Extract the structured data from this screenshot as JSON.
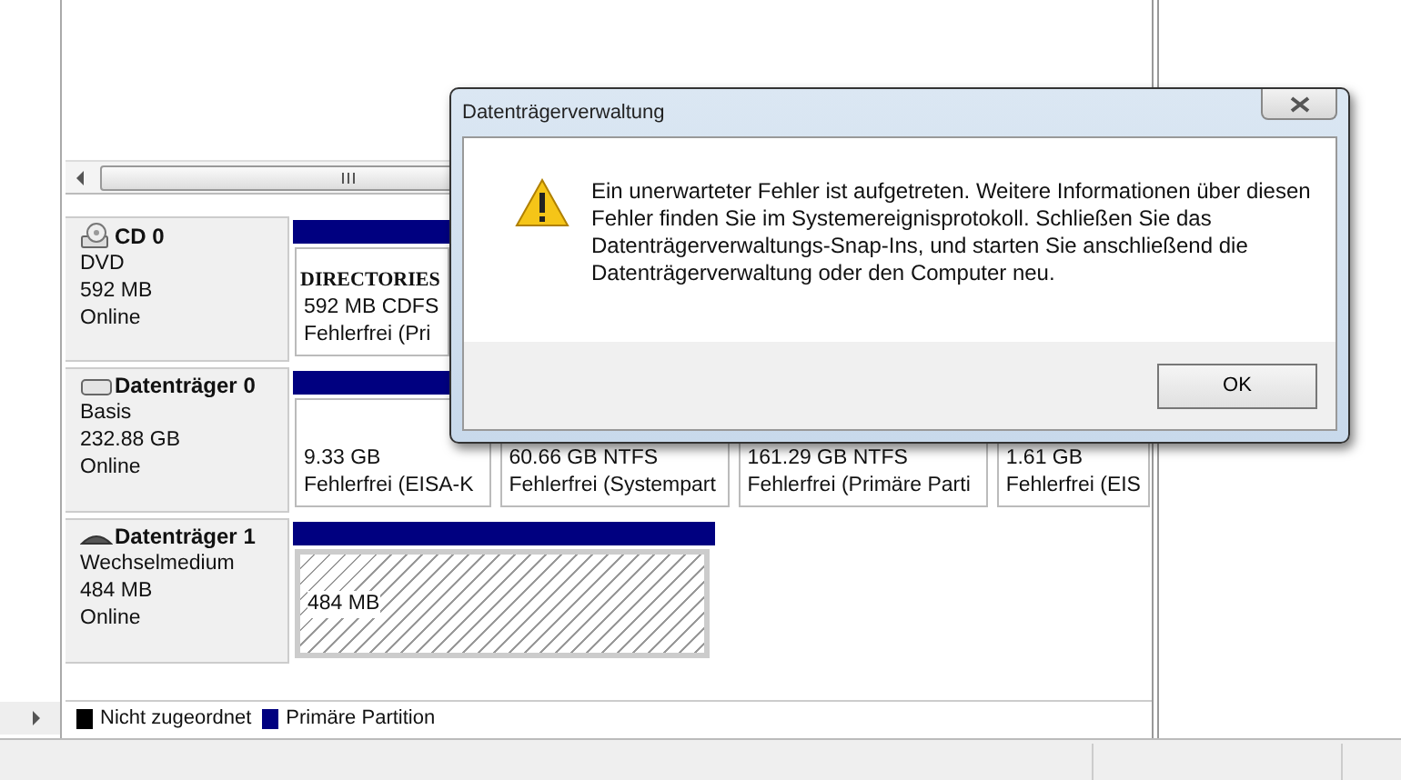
{
  "disks": [
    {
      "kind": "cd",
      "name": "CD 0",
      "type": "DVD",
      "size": "592 MB",
      "status": "Online",
      "partitions": [
        {
          "kind": "plain",
          "title": "DIRECTORIES",
          "lines": [
            "592 MB CDFS",
            "Fehlerfrei (Pri"
          ]
        }
      ]
    },
    {
      "kind": "disk",
      "name": "Datenträger 0",
      "type": "Basis",
      "size": "232.88 GB",
      "status": "Online",
      "partitions": [
        {
          "kind": "plain",
          "lines": [
            "9.33 GB",
            "Fehlerfrei (EISA-K"
          ]
        },
        {
          "kind": "plain",
          "lines": [
            "60.66 GB NTFS",
            "Fehlerfrei (Systempart"
          ]
        },
        {
          "kind": "plain",
          "lines": [
            "161.29 GB NTFS",
            "Fehlerfrei (Primäre Parti"
          ]
        },
        {
          "kind": "plain",
          "lines": [
            "1.61 GB",
            "Fehlerfrei (EIS"
          ]
        }
      ]
    },
    {
      "kind": "removable",
      "name": "Datenträger 1",
      "type": "Wechselmedium",
      "size": "484 MB",
      "status": "Online",
      "partitions": [
        {
          "kind": "hatched",
          "lines": [
            "484 MB"
          ]
        }
      ]
    }
  ],
  "legend": [
    {
      "label": "Nicht zugeordnet",
      "color": "#000000"
    },
    {
      "label": "Primäre Partition",
      "color": "#000080"
    }
  ],
  "dialog": {
    "title": "Datenträgerverwaltung",
    "message": "Ein unerwarteter Fehler ist aufgetreten. Weitere Informationen über diesen Fehler finden Sie im Systemereignisprotokoll. Schließen Sie das Datenträgerverwaltungs-Snap-Ins, und starten Sie anschließend die Datenträgerverwaltung oder den Computer neu.",
    "button": "OK"
  }
}
